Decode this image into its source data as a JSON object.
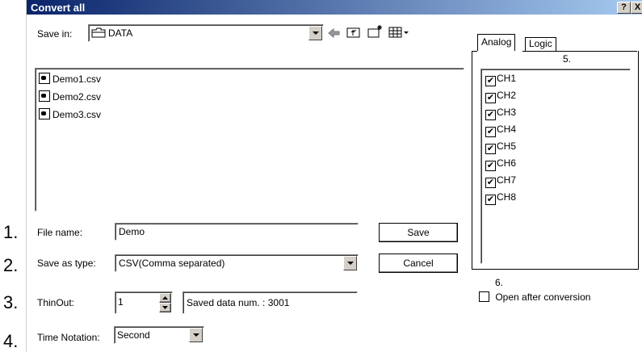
{
  "window": {
    "title": "Convert all",
    "help_btn": "?",
    "close_btn": "X"
  },
  "save_in": {
    "label": "Save in:",
    "value": "DATA"
  },
  "toolbar_icons": [
    "back-icon",
    "up-folder-icon",
    "new-folder-icon",
    "view-menu-icon"
  ],
  "files": [
    "Demo1.csv",
    "Demo2.csv",
    "Demo3.csv"
  ],
  "file_name": {
    "label": "File name:",
    "value": "Demo"
  },
  "save_as_type": {
    "label": "Save as type:",
    "value": "CSV(Comma separated)"
  },
  "thin_out": {
    "label": "ThinOut:",
    "value": "1",
    "saved_data": "Saved data num. : 3001"
  },
  "time_notation": {
    "label": "Time Notation:",
    "value": "Second"
  },
  "buttons": {
    "save": "Save",
    "cancel": "Cancel"
  },
  "tabs": {
    "analog": "Analog",
    "logic": "Logic"
  },
  "channels": [
    "CH1",
    "CH2",
    "CH3",
    "CH4",
    "CH5",
    "CH6",
    "CH7",
    "CH8"
  ],
  "open_after": {
    "label": "Open after conversion",
    "checked": false
  },
  "callouts": {
    "n1": "1.",
    "n2": "2.",
    "n3": "3.",
    "n4": "4.",
    "n5": "5.",
    "n6": "6."
  }
}
